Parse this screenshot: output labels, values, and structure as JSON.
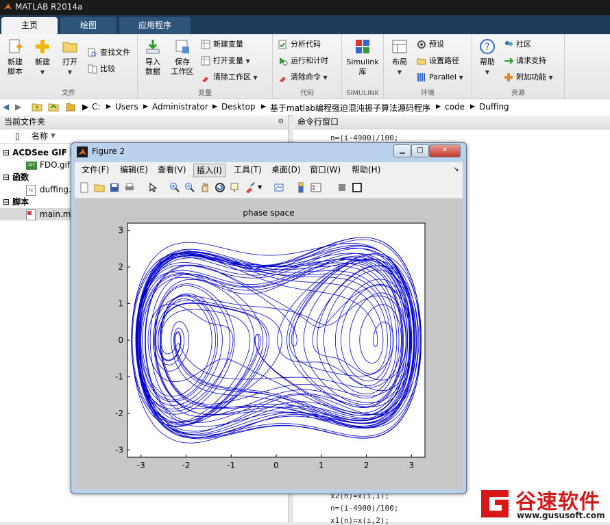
{
  "app": {
    "title": "MATLAB R2014a",
    "tabs": [
      "主页",
      "绘图",
      "应用程序"
    ]
  },
  "ribbon": {
    "groups": {
      "file": "文件",
      "variable": "变量",
      "code": "代码",
      "simulink": "SIMULINK",
      "environment": "环境",
      "resources": "资源"
    },
    "new_script": [
      "新建",
      "脚本"
    ],
    "new": "新建",
    "open": "打开",
    "find_files": "查找文件",
    "compare": "比较",
    "import": [
      "导入",
      "数据"
    ],
    "save_ws": [
      "保存",
      "工作区"
    ],
    "new_var": "新建变量",
    "open_var": "打开变量",
    "clear_ws": "清除工作区",
    "analyze": "分析代码",
    "run_time": "运行和计时",
    "clear_cmd": "清除命令",
    "simulink": [
      "Simulink",
      "库"
    ],
    "layout": "布局",
    "prefs": "预设",
    "set_path": "设置路径",
    "parallel": "Parallel",
    "help": "帮助",
    "community": "社区",
    "support": "请求支持",
    "addons": "附加功能"
  },
  "address": {
    "segments": [
      "C:",
      "Users",
      "Administrator",
      "Desktop",
      "基于matlab编程强迫混沌振子算法源码程序",
      "code",
      "Duffing"
    ]
  },
  "left_panel": {
    "title": "当前文件夹",
    "column": "名称",
    "sections": [
      "ACDSee GIF 图",
      "函数",
      "脚本"
    ],
    "files": [
      "FDO.gif",
      "duffing.m",
      "main.m"
    ]
  },
  "command_window": {
    "title": "命令行窗口",
    "lines_top": [
      "n=(i-4900)/100;"
    ],
    "lines_bottom": [
      "x2(n)=x(i,1);",
      "n=(i-4900)/100;",
      "x1(n)=x(i,2);"
    ]
  },
  "figure": {
    "title": "Figure 2",
    "menus": [
      "文件(F)",
      "编辑(E)",
      "查看(V)",
      "插入(I)",
      "工具(T)",
      "桌面(D)",
      "窗口(W)",
      "帮助(H)"
    ],
    "plot_title": "phase space",
    "xticks": [
      "-3",
      "-2",
      "-1",
      "0",
      "1",
      "2",
      "3"
    ],
    "yticks": [
      "3",
      "2",
      "1",
      "0",
      "-1",
      "-2",
      "-3"
    ]
  },
  "chart_data": {
    "type": "line",
    "title": "phase space",
    "xlabel": "",
    "ylabel": "",
    "xlim": [
      -3.3,
      3.3
    ],
    "ylim": [
      -3.2,
      3.2
    ],
    "grid": false,
    "series": [
      {
        "color": "#0000cc",
        "equation": "Duffing phase portrait (x, dx/dt)"
      }
    ]
  },
  "watermark": {
    "brand": "谷速软件",
    "url": "www.gususoft.com"
  },
  "colors": {
    "trace": "#0000cc",
    "tab_bar": "#1e3b5c"
  }
}
